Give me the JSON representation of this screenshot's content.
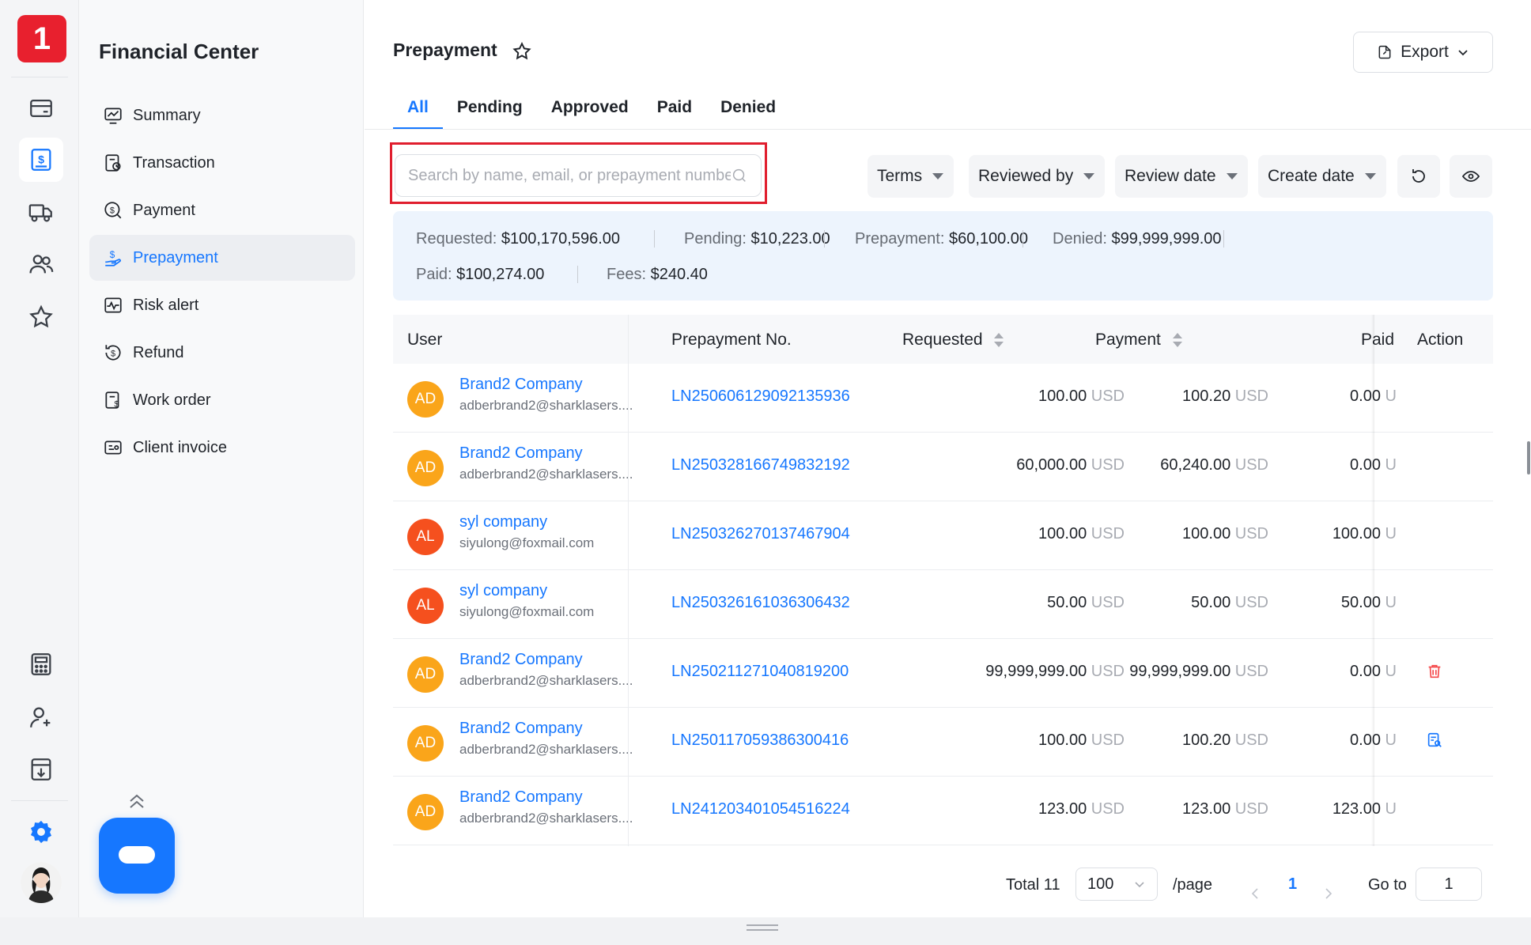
{
  "app": {
    "logo_text": "1"
  },
  "rail": {
    "icons": [
      "wallet-icon",
      "finance-icon",
      "truck-icon",
      "users-icon",
      "star-icon",
      "calculator-icon",
      "user-add-icon",
      "download-doc-icon",
      "settings-icon"
    ],
    "accent": "#1677ff"
  },
  "sidemenu": {
    "title": "Financial Center",
    "items": [
      {
        "label": "Summary",
        "icon": "chart-icon"
      },
      {
        "label": "Transaction",
        "icon": "transaction-icon"
      },
      {
        "label": "Payment",
        "icon": "payment-icon"
      },
      {
        "label": "Prepayment",
        "icon": "prepayment-icon",
        "active": true
      },
      {
        "label": "Risk alert",
        "icon": "risk-icon"
      },
      {
        "label": "Refund",
        "icon": "refund-icon"
      },
      {
        "label": "Work order",
        "icon": "workorder-icon"
      },
      {
        "label": "Client invoice",
        "icon": "invoice-icon"
      }
    ]
  },
  "header": {
    "title": "Prepayment",
    "export_label": "Export"
  },
  "tabs": [
    {
      "label": "All",
      "active": true
    },
    {
      "label": "Pending"
    },
    {
      "label": "Approved"
    },
    {
      "label": "Paid"
    },
    {
      "label": "Denied"
    }
  ],
  "search": {
    "placeholder": "Search by name, email, or prepayment number"
  },
  "filters": {
    "terms": "Terms",
    "reviewed_by": "Reviewed by",
    "review_date": "Review date",
    "create_date": "Create date"
  },
  "stats": {
    "requested_label": "Requested:",
    "requested_value": "$100,170,596.00",
    "pending_label": "Pending:",
    "pending_value": "$10,223.00",
    "prepayment_label": "Prepayment:",
    "prepayment_value": "$60,100.00",
    "denied_label": "Denied:",
    "denied_value": "$99,999,999.00",
    "paid_label": "Paid:",
    "paid_value": "$100,274.00",
    "fees_label": "Fees:",
    "fees_value": "$240.40"
  },
  "table": {
    "headers": {
      "user": "User",
      "prepayment_no": "Prepayment No.",
      "requested": "Requested",
      "payment": "Payment",
      "paid": "Paid",
      "action": "Action"
    },
    "currency": "USD",
    "paid_currency_fragment": "U",
    "rows": [
      {
        "initials": "AD",
        "avatar_color": "#faa51a",
        "name": "Brand2 Company",
        "email": "adberbrand2@sharklasers....",
        "no": "LN250606129092135936",
        "requested": "100.00",
        "payment": "100.20",
        "paid": "0.00",
        "action": ""
      },
      {
        "initials": "AD",
        "avatar_color": "#faa51a",
        "name": "Brand2 Company",
        "email": "adberbrand2@sharklasers....",
        "no": "LN250328166749832192",
        "requested": "60,000.00",
        "payment": "60,240.00",
        "paid": "0.00",
        "action": ""
      },
      {
        "initials": "AL",
        "avatar_color": "#f5501e",
        "name": "syl company",
        "email": "siyulong@foxmail.com",
        "no": "LN250326270137467904",
        "requested": "100.00",
        "payment": "100.00",
        "paid": "100.00",
        "action": ""
      },
      {
        "initials": "AL",
        "avatar_color": "#f5501e",
        "name": "syl company",
        "email": "siyulong@foxmail.com",
        "no": "LN250326161036306432",
        "requested": "50.00",
        "payment": "50.00",
        "paid": "50.00",
        "action": ""
      },
      {
        "initials": "AD",
        "avatar_color": "#faa51a",
        "name": "Brand2 Company",
        "email": "adberbrand2@sharklasers....",
        "no": "LN250211271040819200",
        "requested": "99,999,999.00",
        "payment": "99,999,999.00",
        "paid": "0.00",
        "action": "delete-icon"
      },
      {
        "initials": "AD",
        "avatar_color": "#faa51a",
        "name": "Brand2 Company",
        "email": "adberbrand2@sharklasers....",
        "no": "LN250117059386300416",
        "requested": "100.00",
        "payment": "100.20",
        "paid": "0.00",
        "action": "review-doc-icon"
      },
      {
        "initials": "AD",
        "avatar_color": "#faa51a",
        "name": "Brand2 Company",
        "email": "adberbrand2@sharklasers....",
        "no": "LN241203401054516224",
        "requested": "123.00",
        "payment": "123.00",
        "paid": "123.00",
        "action": ""
      }
    ]
  },
  "pagination": {
    "total": "Total 11",
    "page_size": "100",
    "per_page": "/page",
    "current": "1",
    "goto_label": "Go to",
    "goto_value": "1"
  }
}
